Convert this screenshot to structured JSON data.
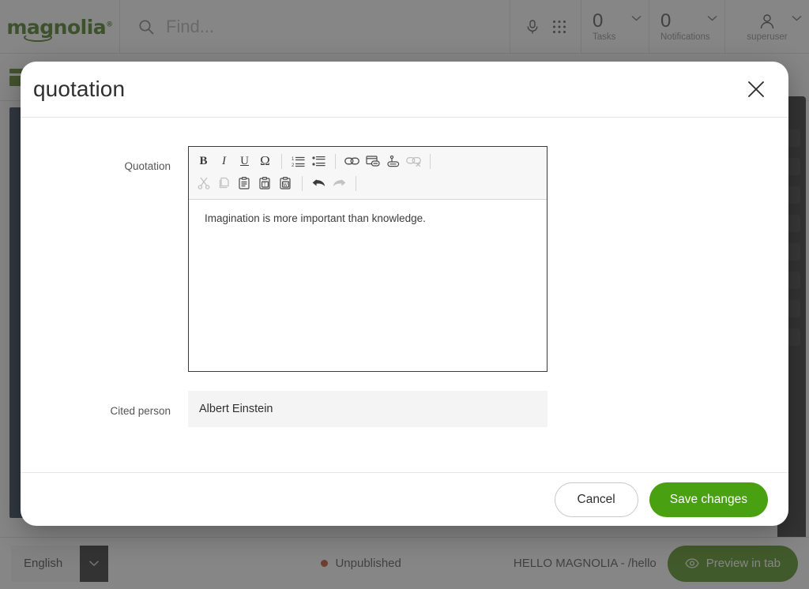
{
  "topbar": {
    "logo": "magnolia",
    "logo_mark": "registered-trademark",
    "search_placeholder": "Find...",
    "mic_icon": "microphone-icon",
    "apps_icon": "app-grid-icon",
    "tasks": {
      "count": "0",
      "label": "Tasks",
      "chevron": "chevron-down-icon"
    },
    "notifications": {
      "count": "0",
      "label": "Notifications",
      "chevron": "chevron-down-icon"
    },
    "user": {
      "name": "superuser",
      "avatar_icon": "user-avatar-icon",
      "chevron": "chevron-down-icon"
    }
  },
  "appbar": {
    "pages_app_icon": "pages-app-icon"
  },
  "modal": {
    "title": "quotation",
    "close_icon": "close-icon",
    "fields": {
      "quotation": {
        "label": "Quotation",
        "value": "Imagination is more important than knowledge."
      },
      "cited_person": {
        "label": "Cited person",
        "value": "Albert Einstein",
        "placeholder": ""
      }
    },
    "toolbar": {
      "row1": [
        {
          "name": "bold-icon",
          "glyph": "B",
          "style": "bold",
          "enabled": true
        },
        {
          "name": "italic-icon",
          "glyph": "I",
          "style": "italic",
          "enabled": true
        },
        {
          "name": "underline-icon",
          "glyph": "U",
          "style": "underline",
          "enabled": true
        },
        {
          "name": "special-character-icon",
          "glyph": "Ω",
          "style": "plain",
          "enabled": true
        },
        {
          "name": "separator",
          "glyph": "",
          "style": "sep",
          "enabled": false
        },
        {
          "name": "numbered-list-icon",
          "glyph": "",
          "style": "svg-numlist",
          "enabled": true
        },
        {
          "name": "bulleted-list-icon",
          "glyph": "",
          "style": "svg-bullist",
          "enabled": true
        },
        {
          "name": "separator",
          "glyph": "",
          "style": "sep",
          "enabled": false
        },
        {
          "name": "link-icon",
          "glyph": "",
          "style": "svg-link",
          "enabled": true
        },
        {
          "name": "internal-page-link-icon",
          "glyph": "",
          "style": "svg-pagelink",
          "enabled": true
        },
        {
          "name": "anchor-link-icon",
          "glyph": "",
          "style": "svg-anchor",
          "enabled": true
        },
        {
          "name": "unlink-icon",
          "glyph": "",
          "style": "svg-unlink",
          "enabled": false
        },
        {
          "name": "separator",
          "glyph": "",
          "style": "sep",
          "enabled": false
        }
      ],
      "row2": [
        {
          "name": "cut-icon",
          "glyph": "",
          "style": "svg-cut",
          "enabled": false
        },
        {
          "name": "copy-icon",
          "glyph": "",
          "style": "svg-copy",
          "enabled": false
        },
        {
          "name": "paste-icon",
          "glyph": "",
          "style": "svg-paste",
          "enabled": true
        },
        {
          "name": "paste-as-plain-text-icon",
          "glyph": "T",
          "style": "svg-paste-t",
          "enabled": true
        },
        {
          "name": "paste-from-word-icon",
          "glyph": "W",
          "style": "svg-paste-w",
          "enabled": true
        },
        {
          "name": "separator",
          "glyph": "",
          "style": "sep",
          "enabled": false
        },
        {
          "name": "undo-icon",
          "glyph": "",
          "style": "svg-undo",
          "enabled": true
        },
        {
          "name": "redo-icon",
          "glyph": "",
          "style": "svg-redo",
          "enabled": false
        },
        {
          "name": "separator",
          "glyph": "",
          "style": "sep",
          "enabled": false
        }
      ]
    },
    "footer": {
      "cancel_label": "Cancel",
      "save_label": "Save changes"
    }
  },
  "statusbar": {
    "language": "English",
    "language_chevron": "chevron-down-icon",
    "publication_status": "Unpublished",
    "publication_dot_color": "#c0421a",
    "page_path": "HELLO MAGNOLIA - /hello",
    "preview_label": "Preview in tab",
    "preview_icon": "eye-icon"
  },
  "colors": {
    "brand_green": "#3d7314",
    "save_green": "#49a010",
    "preview_green": "#4a8c10",
    "navy_panel": "#22344a",
    "unpublished": "#c0421a"
  }
}
